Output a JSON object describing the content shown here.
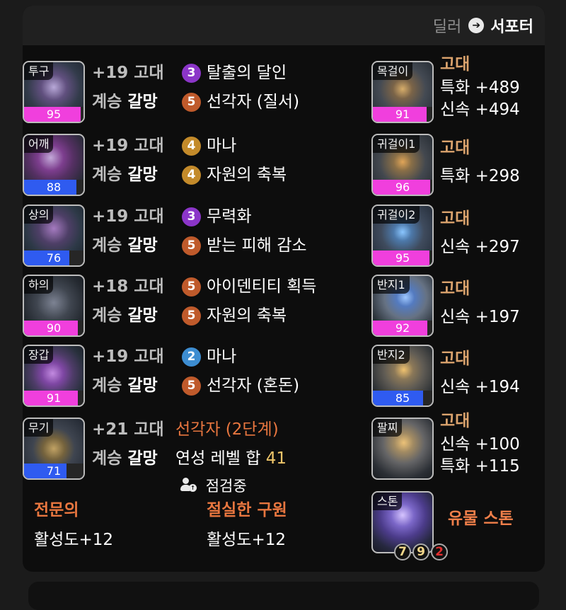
{
  "top_toggle": {
    "dealer": "딜러",
    "support": "서포터",
    "arrow": "➔"
  },
  "equipment": [
    {
      "slot": "투구",
      "quality": 95,
      "quality_color": "magenta",
      "line1": {
        "prefix": "+19",
        "grade": "고대"
      },
      "line2": {
        "prefix": "계승",
        "set": "갈망"
      },
      "effects": [
        {
          "level": "3",
          "name": "탈출의 달인",
          "color": "purple"
        },
        {
          "level": "5",
          "name": "선각자 (질서)",
          "color": "orange-c"
        }
      ]
    },
    {
      "slot": "어깨",
      "quality": 88,
      "quality_color": "blue",
      "line1": {
        "prefix": "+19",
        "grade": "고대"
      },
      "line2": {
        "prefix": "계승",
        "set": "갈망"
      },
      "effects": [
        {
          "level": "4",
          "name": "마나",
          "color": "yellow-c"
        },
        {
          "level": "4",
          "name": "자원의 축복",
          "color": "yellow-c"
        }
      ]
    },
    {
      "slot": "상의",
      "quality": 76,
      "quality_color": "blue",
      "line1": {
        "prefix": "+19",
        "grade": "고대"
      },
      "line2": {
        "prefix": "계승",
        "set": "갈망"
      },
      "effects": [
        {
          "level": "3",
          "name": "무력화",
          "color": "purple"
        },
        {
          "level": "5",
          "name": "받는 피해 감소",
          "color": "orange-c"
        }
      ]
    },
    {
      "slot": "하의",
      "quality": 90,
      "quality_color": "magenta",
      "line1": {
        "prefix": "+18",
        "grade": "고대"
      },
      "line2": {
        "prefix": "계승",
        "set": "갈망"
      },
      "effects": [
        {
          "level": "5",
          "name": "아이덴티티 획득",
          "color": "orange-c"
        },
        {
          "level": "5",
          "name": "자원의 축복",
          "color": "orange-c"
        }
      ]
    },
    {
      "slot": "장갑",
      "quality": 91,
      "quality_color": "magenta",
      "line1": {
        "prefix": "+19",
        "grade": "고대"
      },
      "line2": {
        "prefix": "계승",
        "set": "갈망"
      },
      "effects": [
        {
          "level": "2",
          "name": "마나",
          "color": "blue-c"
        },
        {
          "level": "5",
          "name": "선각자 (혼돈)",
          "color": "orange-c"
        }
      ]
    },
    {
      "slot": "무기",
      "quality": 71,
      "quality_color": "blue",
      "line1": {
        "prefix": "+21",
        "grade": "고대"
      },
      "line2": {
        "prefix": "계승",
        "set": "갈망"
      },
      "weapon_info": {
        "title": "선각자 (2단계)",
        "level_label": "연성 레벨 합",
        "level_value": "41",
        "status": "점검중"
      }
    }
  ],
  "accessories": [
    {
      "slot": "목걸이",
      "quality": 91,
      "quality_color": "magenta",
      "grade": "고대",
      "stats": [
        "특화 +489",
        "신속 +494"
      ]
    },
    {
      "slot": "귀걸이1",
      "quality": 96,
      "quality_color": "magenta",
      "grade": "고대",
      "stats": [
        "특화 +298"
      ]
    },
    {
      "slot": "귀걸이2",
      "quality": 95,
      "quality_color": "magenta",
      "grade": "고대",
      "stats": [
        "신속 +297"
      ]
    },
    {
      "slot": "반지1",
      "quality": 92,
      "quality_color": "magenta",
      "grade": "고대",
      "stats": [
        "신속 +197"
      ]
    },
    {
      "slot": "반지2",
      "quality": 85,
      "quality_color": "blue",
      "grade": "고대",
      "stats": [
        "신속 +194"
      ]
    },
    {
      "slot": "팔찌",
      "quality": null,
      "quality_color": "none",
      "grade": "고대",
      "stats": [
        "신속 +100",
        "특화 +115"
      ]
    }
  ],
  "stone": {
    "slot": "스톤",
    "title": "유물 스톤",
    "values": [
      "7",
      "9",
      "2"
    ]
  },
  "bottom_sections": [
    {
      "title": "전문의",
      "value": "활성도+12"
    },
    {
      "title": "절실한 구원",
      "value": "활성도+12"
    }
  ],
  "colors": {
    "background": "#1b1b1b",
    "panel": "#0d0d0d",
    "quality_magenta": "#f03fdd",
    "quality_blue": "#2f5bf0",
    "orange_text": "#e8763f",
    "gold_text": "#dba36d"
  }
}
